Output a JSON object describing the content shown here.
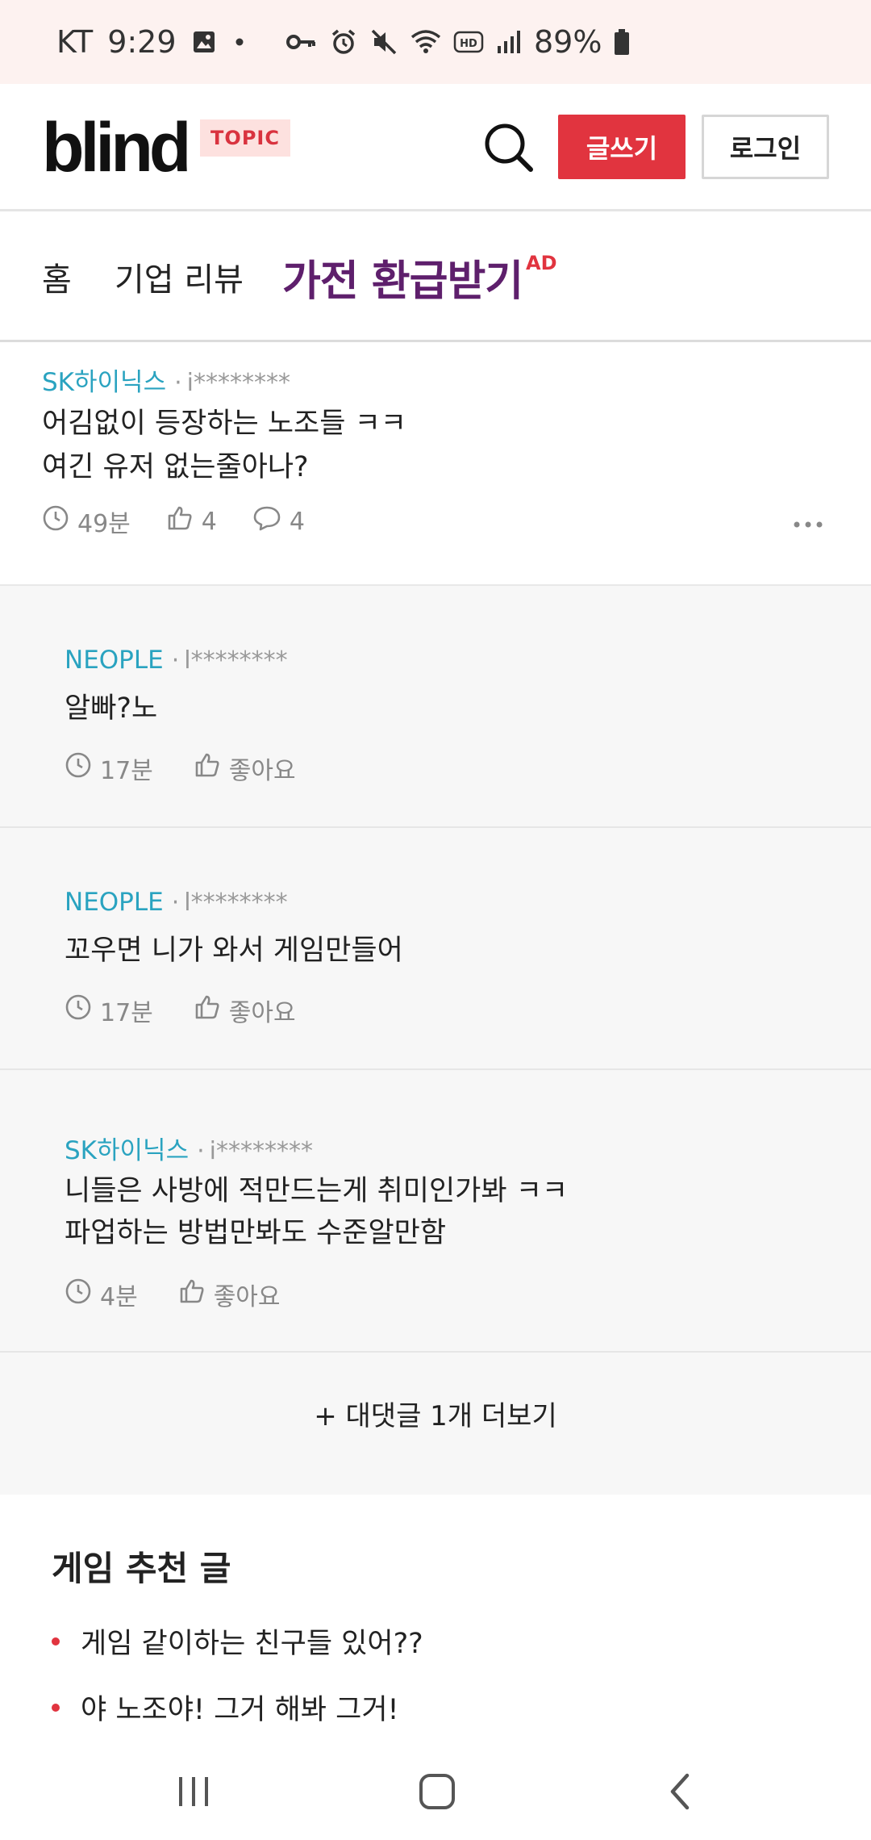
{
  "status_bar": {
    "carrier": "KT",
    "time": "9:29",
    "battery": "89%",
    "icons": [
      "image-icon",
      "dot-icon",
      "vpn-key-icon",
      "alarm-icon",
      "mute-icon",
      "wifi-icon",
      "hd-icon",
      "signal-icon",
      "battery-icon"
    ]
  },
  "header": {
    "logo": "blind",
    "badge": "TOPIC",
    "write_label": "글쓰기",
    "login_label": "로그인"
  },
  "nav": {
    "home": "홈",
    "review": "기업 리뷰",
    "ad_text": "가전 환급받기",
    "ad_tag": "AD"
  },
  "post": {
    "company": "SK하이닉스",
    "user": "i********",
    "line1": "어김없이 등장하는 노조들 ㅋㅋ",
    "line2": "여긴 유저 없는줄아나?",
    "time": "49분",
    "likes": "4",
    "comments": "4"
  },
  "comments": [
    {
      "company": "NEOPLE",
      "user": "l********",
      "lines": [
        "알빠?노"
      ],
      "time": "17분",
      "like_label": "좋아요"
    },
    {
      "company": "NEOPLE",
      "user": "l********",
      "lines": [
        "꼬우면 니가 와서 게임만들어"
      ],
      "time": "17분",
      "like_label": "좋아요"
    },
    {
      "company": "SK하이닉스",
      "user": "i********",
      "lines": [
        "니들은 사방에 적만드는게 취미인가봐 ㅋㅋ",
        "파업하는 방법만봐도 수준알만함"
      ],
      "time": "4분",
      "like_label": "좋아요"
    }
  ],
  "more_replies": "+ 대댓글 1개 더보기",
  "recommended": {
    "title": "게임 추천 글",
    "items": [
      "게임 같이하는 친구들 있어??",
      "야 노조야! 그거 해봐 그거!"
    ]
  },
  "colors": {
    "accent": "#e1343f",
    "company": "#2aa3c0",
    "status_bg": "#fdf2f0"
  }
}
